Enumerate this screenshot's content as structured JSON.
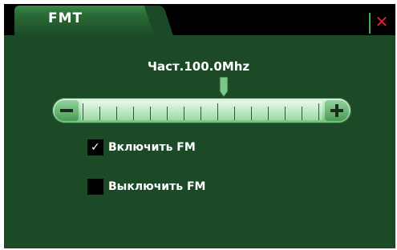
{
  "window": {
    "tab_title": "FMT",
    "close_symbol": "✕"
  },
  "frequency": {
    "label": "Част.100.0Mhz"
  },
  "slider": {
    "minus_icon": "minus-icon",
    "plus_icon": "plus-icon"
  },
  "options": [
    {
      "label": "Включить FM",
      "checked": true
    },
    {
      "label": "Выключить FM",
      "checked": false
    }
  ],
  "colors": {
    "panel": "#1c4a27",
    "accent": "#3fb04f",
    "close": "#e0202c"
  }
}
